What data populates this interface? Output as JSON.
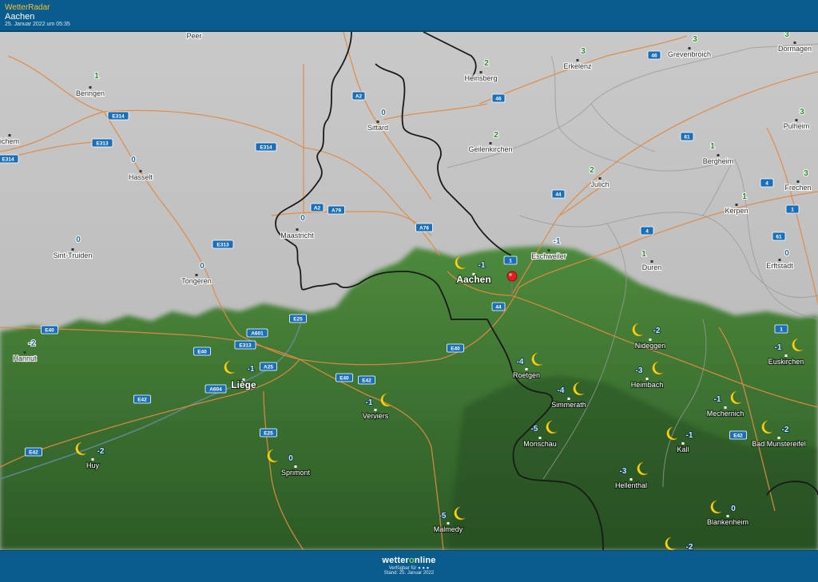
{
  "header": {
    "app_name": "WetterRadar",
    "location": "Aachen",
    "timestamp": "25. Januar 2022 um 05:35"
  },
  "footer": {
    "brand_prefix": "wetter",
    "brand_o": "o",
    "brand_suffix": "nline",
    "available_text": "Verfügbar für ● ● ●",
    "updated_text": "Stand: 25. Januar 2022"
  },
  "colors": {
    "bar": "#0b5c8e",
    "header_accent": "#f2c230",
    "temp_zero": "#2d6f9a",
    "temp_positive": "#2e8a2e",
    "moon": "#f7d51d",
    "road": "#e58b43",
    "shield": "#1b6fb8",
    "pin": "#e02020"
  },
  "cities": [
    {
      "name": "Peer",
      "temp": "",
      "moon": false
    },
    {
      "name": "Beringen",
      "temp": "1",
      "moon": false
    },
    {
      "name": "ichem",
      "temp": "",
      "moon": false
    },
    {
      "name": "Hasselt",
      "temp": "0",
      "moon": false
    },
    {
      "name": "Sint-Truiden",
      "temp": "0",
      "moon": false
    },
    {
      "name": "Tongeren",
      "temp": "0",
      "moon": false
    },
    {
      "name": "Hannut",
      "temp": "-2",
      "moon": false
    },
    {
      "name": "Maastricht",
      "temp": "0",
      "moon": false
    },
    {
      "name": "Sittard",
      "temp": "0",
      "moon": false
    },
    {
      "name": "Heinsberg",
      "temp": "2",
      "moon": false
    },
    {
      "name": "Geilenkirchen",
      "temp": "2",
      "moon": false
    },
    {
      "name": "Erkelenz",
      "temp": "3",
      "moon": false
    },
    {
      "name": "Grevenbroich",
      "temp": "3",
      "moon": false
    },
    {
      "name": "Dormagen",
      "temp": "3",
      "moon": false
    },
    {
      "name": "Julich",
      "temp": "2",
      "moon": false
    },
    {
      "name": "Bergheim",
      "temp": "1",
      "moon": false
    },
    {
      "name": "Pulheim",
      "temp": "3",
      "moon": false
    },
    {
      "name": "Kerpen",
      "temp": "1",
      "moon": false
    },
    {
      "name": "Frechen",
      "temp": "3",
      "moon": false
    },
    {
      "name": "Aachen",
      "temp": "-1",
      "moon": true
    },
    {
      "name": "Eschweiler",
      "temp": "-1",
      "moon": false
    },
    {
      "name": "Duren",
      "temp": "1",
      "moon": false
    },
    {
      "name": "Erftstadt",
      "temp": "0",
      "moon": false
    },
    {
      "name": "Liège",
      "temp": "-1",
      "moon": true
    },
    {
      "name": "Verviers",
      "temp": "-1",
      "moon": true
    },
    {
      "name": "Roetgen",
      "temp": "-4",
      "moon": true
    },
    {
      "name": "Nideggen",
      "temp": "-2",
      "moon": true
    },
    {
      "name": "Euskirchen",
      "temp": "-1",
      "moon": true
    },
    {
      "name": "Heimbach",
      "temp": "-3",
      "moon": true
    },
    {
      "name": "Simmerath",
      "temp": "-4",
      "moon": true
    },
    {
      "name": "Mechernich",
      "temp": "-1",
      "moon": true
    },
    {
      "name": "Monschau",
      "temp": "-5",
      "moon": true
    },
    {
      "name": "Bad Munstereifel",
      "temp": "-2",
      "moon": true
    },
    {
      "name": "Kall",
      "temp": "-1",
      "moon": true
    },
    {
      "name": "Huy",
      "temp": "-2",
      "moon": true
    },
    {
      "name": "Sprimont",
      "temp": "0",
      "moon": true
    },
    {
      "name": "Hellenthal",
      "temp": "-3",
      "moon": true
    },
    {
      "name": "Blankenheim",
      "temp": "0",
      "moon": true
    },
    {
      "name": "Malmedy",
      "temp": "-5",
      "moon": true
    },
    {
      "name": "",
      "temp": "-2",
      "moon": true
    }
  ],
  "road_shields": [
    "E314",
    "E313",
    "E314",
    "E314",
    "A2",
    "46",
    "46",
    "61",
    "4",
    "1",
    "61",
    "A2",
    "A79",
    "A76",
    "44",
    "4",
    "E313",
    "A601",
    "E313",
    "E25",
    "A25",
    "E40",
    "E40",
    "E40",
    "E42",
    "E42",
    "A604",
    "E25",
    "E42",
    "E40",
    "44",
    "1",
    "1",
    "E42"
  ]
}
